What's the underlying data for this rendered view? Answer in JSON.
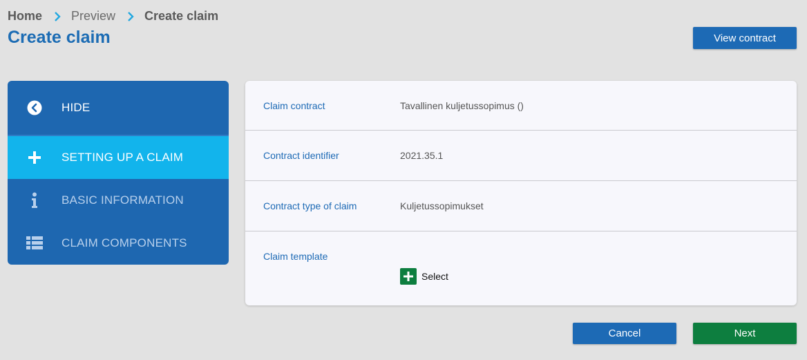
{
  "breadcrumb": {
    "items": [
      "Home",
      "Preview",
      "Create claim"
    ]
  },
  "page": {
    "title": "Create claim",
    "view_contract_label": "View contract"
  },
  "sidebar": {
    "items": [
      {
        "label": "HIDE",
        "icon": "chevron-left-circle-icon"
      },
      {
        "label": "SETTING UP A CLAIM",
        "icon": "plus-icon",
        "active": true
      },
      {
        "label": "BASIC INFORMATION",
        "icon": "info-icon"
      },
      {
        "label": "CLAIM COMPONENTS",
        "icon": "list-icon"
      }
    ]
  },
  "details": {
    "claim_contract": {
      "label": "Claim contract",
      "value": "Tavallinen kuljetussopimus ()"
    },
    "contract_identifier": {
      "label": "Contract identifier",
      "value": "2021.35.1"
    },
    "contract_type": {
      "label": "Contract type of claim",
      "value": "Kuljetussopimukset"
    },
    "claim_template": {
      "label": "Claim template",
      "select_label": "Select"
    }
  },
  "footer": {
    "cancel_label": "Cancel",
    "next_label": "Next"
  },
  "colors": {
    "primary": "#1d6ab5",
    "active_nav": "#12b4ec",
    "success": "#0d7e3f"
  }
}
